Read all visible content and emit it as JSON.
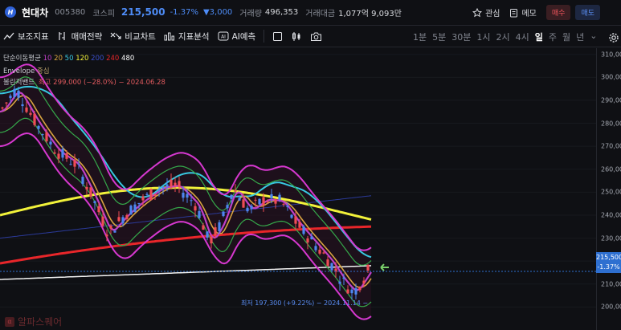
{
  "header": {
    "logo_text": "H",
    "name": "현대차",
    "code": "005380",
    "market": "코스피",
    "price": "215,500",
    "change_rate": "-1.37%",
    "change": "▼3,000",
    "volume_label": "거래량",
    "volume": "496,353",
    "amount_label": "거래대금",
    "amount": "1,077억 9,093만",
    "watch_label": "관심",
    "memo_label": "메모",
    "buy_label": "매수",
    "sell_label": "매도"
  },
  "toolbar": {
    "indicators": "보조지표",
    "trade_strategy": "매매전략",
    "compare": "비교차트",
    "analysis": "지표분석",
    "ai_predict": "AI예측",
    "periods": [
      "1분",
      "5분",
      "30분",
      "1시",
      "2시",
      "4시",
      "일",
      "주",
      "월",
      "년"
    ],
    "active_period": "일"
  },
  "legend": {
    "ma_label": "단순이동평균",
    "ma_periods": [
      {
        "label": "10",
        "color": "#c040c8"
      },
      {
        "label": "20",
        "color": "#d9a441"
      },
      {
        "label": "50",
        "color": "#38c8e0"
      },
      {
        "label": "120",
        "color": "#f2f23a"
      },
      {
        "label": "200",
        "color": "#3a4ec8"
      },
      {
        "label": "240",
        "color": "#e8262a"
      },
      {
        "label": "480",
        "color": "#ffffff"
      }
    ],
    "envelope_label": "Envelope",
    "envelope_value": "중심",
    "bollinger_label": "볼린저밴드",
    "high_label": "최고 299,000 (−28.0%) − 2024.06.28"
  },
  "chart": {
    "low_label": "최저 197,300 (+9.22%) − 2024.11.14 −",
    "current_price": "215,500",
    "current_rate": "-1.37%",
    "y_ticks": [
      "310,000",
      "300,000",
      "290,000",
      "280,000",
      "270,000",
      "260,000",
      "250,000",
      "240,000",
      "230,000",
      "220,000",
      "210,000",
      "200,000"
    ],
    "ylim": [
      190000,
      312000
    ],
    "colors": {
      "up": "#ef4d55",
      "down": "#4d86f0",
      "band": "#d638d0",
      "envelope": "#35a84a",
      "last": "#2e6fd0"
    }
  },
  "watermark": "알파스퀘어"
}
